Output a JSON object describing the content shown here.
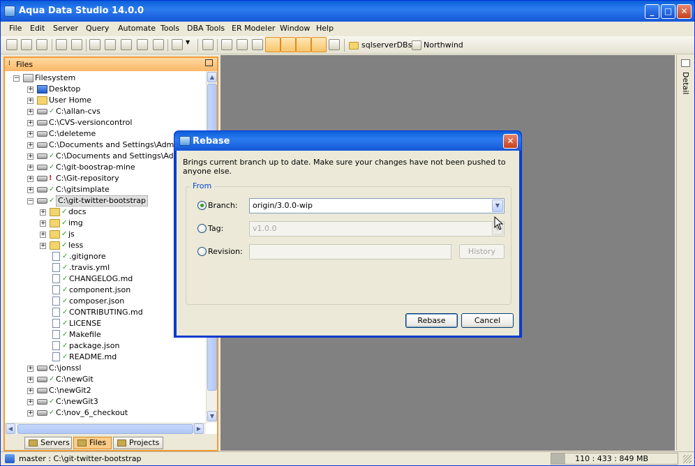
{
  "window": {
    "title": "Aqua Data Studio 14.0.0",
    "min": "_",
    "max": "□",
    "close": "✕"
  },
  "menu": [
    "File",
    "Edit",
    "Server",
    "Query",
    "Automate",
    "Tools",
    "DBA Tools",
    "ER Modeler",
    "Window",
    "Help"
  ],
  "toolbar": {
    "link1": "sqlserverDBs",
    "link2": "Northwind"
  },
  "files_panel": {
    "title": "Files",
    "tree": [
      {
        "label": "Filesystem",
        "level": 0,
        "icon": "filesystem-icon",
        "exp": "−",
        "status": ""
      },
      {
        "label": "Desktop",
        "level": 1,
        "icon": "desktop-icon",
        "exp": "+",
        "status": ""
      },
      {
        "label": "User Home",
        "level": 1,
        "icon": "user-home-icon",
        "exp": "+",
        "status": ""
      },
      {
        "label": "C:\\allan-cvs",
        "level": 1,
        "icon": "drive-icon",
        "exp": "+",
        "status": "ok"
      },
      {
        "label": "C:\\CVS-versioncontrol",
        "level": 1,
        "icon": "drive-icon",
        "exp": "+",
        "status": ""
      },
      {
        "label": "C:\\deleteme",
        "level": 1,
        "icon": "drive-icon",
        "exp": "+",
        "status": ""
      },
      {
        "label": "C:\\Documents and Settings\\Administrator",
        "level": 1,
        "icon": "drive-icon",
        "exp": "+",
        "status": ""
      },
      {
        "label": "C:\\Documents and Settings\\Administrator",
        "level": 1,
        "icon": "drive-icon",
        "exp": "+",
        "status": "ok"
      },
      {
        "label": "C:\\git-boostrap-mine",
        "level": 1,
        "icon": "drive-icon",
        "exp": "+",
        "status": "ok"
      },
      {
        "label": "C:\\Git-repository",
        "level": 1,
        "icon": "drive-icon",
        "exp": "+",
        "status": "warn"
      },
      {
        "label": "C:\\gitsimplate",
        "level": 1,
        "icon": "drive-icon",
        "exp": "+",
        "status": "ok"
      },
      {
        "label": "C:\\git-twitter-bootstrap",
        "level": 1,
        "icon": "drive-icon",
        "exp": "−",
        "status": "ok",
        "selected": true
      },
      {
        "label": "docs",
        "level": 2,
        "icon": "folder-icon",
        "exp": "+",
        "status": "ok"
      },
      {
        "label": "img",
        "level": 2,
        "icon": "folder-icon",
        "exp": "+",
        "status": "ok"
      },
      {
        "label": "js",
        "level": 2,
        "icon": "folder-icon",
        "exp": "+",
        "status": "ok"
      },
      {
        "label": "less",
        "level": 2,
        "icon": "folder-icon",
        "exp": "+",
        "status": "ok"
      },
      {
        "label": ".gitignore",
        "level": 3,
        "icon": "file-icon",
        "exp": "",
        "status": "ok"
      },
      {
        "label": ".travis.yml",
        "level": 3,
        "icon": "file-icon",
        "exp": "",
        "status": "ok"
      },
      {
        "label": "CHANGELOG.md",
        "level": 3,
        "icon": "file-icon",
        "exp": "",
        "status": "ok"
      },
      {
        "label": "component.json",
        "level": 3,
        "icon": "file-icon",
        "exp": "",
        "status": "ok"
      },
      {
        "label": "composer.json",
        "level": 3,
        "icon": "file-icon",
        "exp": "",
        "status": "ok"
      },
      {
        "label": "CONTRIBUTING.md",
        "level": 3,
        "icon": "file-icon",
        "exp": "",
        "status": "ok"
      },
      {
        "label": "LICENSE",
        "level": 3,
        "icon": "file-icon",
        "exp": "",
        "status": "ok"
      },
      {
        "label": "Makefile",
        "level": 3,
        "icon": "file-icon",
        "exp": "",
        "status": "ok"
      },
      {
        "label": "package.json",
        "level": 3,
        "icon": "file-icon",
        "exp": "",
        "status": "ok"
      },
      {
        "label": "README.md",
        "level": 3,
        "icon": "file-icon",
        "exp": "",
        "status": "ok"
      },
      {
        "label": "C:\\jonssl",
        "level": 1,
        "icon": "drive-icon",
        "exp": "+",
        "status": ""
      },
      {
        "label": "C:\\newGit",
        "level": 1,
        "icon": "drive-icon",
        "exp": "+",
        "status": "ok"
      },
      {
        "label": "C:\\newGit2",
        "level": 1,
        "icon": "drive-icon",
        "exp": "+",
        "status": ""
      },
      {
        "label": "C:\\newGit3",
        "level": 1,
        "icon": "drive-icon",
        "exp": "+",
        "status": "ok"
      },
      {
        "label": "C:\\nov_6_checkout",
        "level": 1,
        "icon": "drive-icon",
        "exp": "+",
        "status": "ok"
      }
    ],
    "tabs": [
      "Servers",
      "Files",
      "Projects"
    ]
  },
  "detail_label": "Detail",
  "dialog": {
    "title": "Rebase",
    "description": "Brings current branch up to date. Make sure your changes have not been pushed to anyone else.",
    "group_label": "From",
    "branch_label": "Branch:",
    "branch_value": "origin/3.0.0-wip",
    "tag_label": "Tag:",
    "tag_value": "v1.0.0",
    "revision_label": "Revision:",
    "history_button": "History",
    "ok_button": "Rebase",
    "cancel_button": "Cancel"
  },
  "status": {
    "text": "master : C:\\git-twitter-bootstrap",
    "memory": "110 : 433 : 849 MB"
  }
}
